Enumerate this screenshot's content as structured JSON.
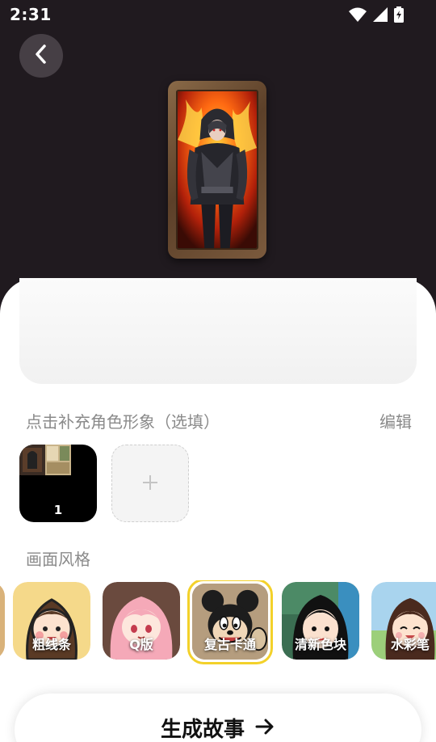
{
  "status_bar": {
    "time": "2:31",
    "icons": [
      "wifi-icon",
      "signal-icon",
      "battery-charging-icon"
    ]
  },
  "header": {
    "back_icon": "chevron-left-icon"
  },
  "character_section": {
    "label": "点击补充角色形象（选填）",
    "edit_label": "编辑",
    "thumbnails": [
      {
        "count": "1"
      }
    ],
    "add_icon": "plus-icon"
  },
  "style_section": {
    "label": "画面风格",
    "options": [
      {
        "label": "粗线条",
        "selected": false
      },
      {
        "label": "Q版",
        "selected": false
      },
      {
        "label": "复古卡通",
        "selected": true
      },
      {
        "label": "清新色块",
        "selected": false
      },
      {
        "label": "水彩笔",
        "selected": false
      }
    ]
  },
  "generate_button": {
    "label": "生成故事",
    "icon": "arrow-right-icon"
  },
  "colors": {
    "background": "#201a1f",
    "selected_border": "#f3d12a",
    "sheet": "#ffffff"
  }
}
